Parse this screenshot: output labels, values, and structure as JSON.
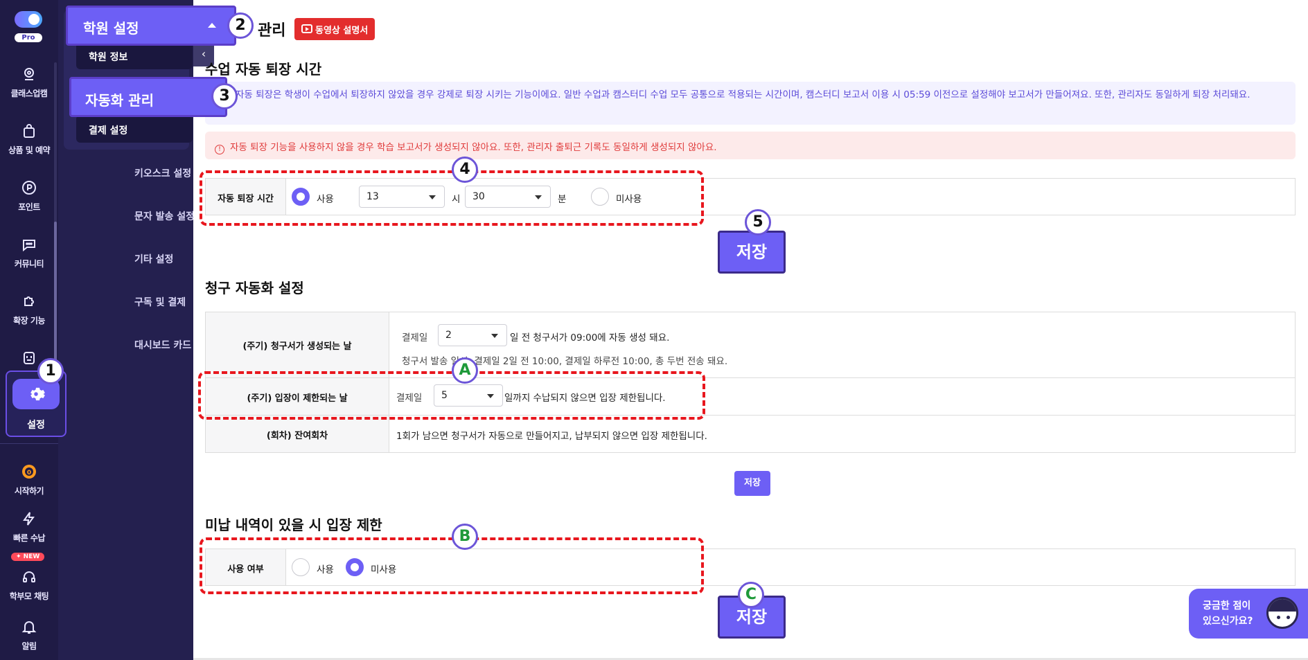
{
  "rail": {
    "pro_label": "Pro",
    "items": [
      {
        "label": "클래스업캠",
        "icon": "pin-icon"
      },
      {
        "label": "상품 및 예약",
        "icon": "bag-icon"
      },
      {
        "label": "포인트",
        "icon": "point-icon"
      },
      {
        "label": "커뮤니티",
        "icon": "chat-icon"
      },
      {
        "label": "확장 기능",
        "icon": "puzzle-icon"
      },
      {
        "label": "",
        "icon": "kiosk-icon"
      }
    ],
    "settings_label": "설정",
    "bottom_items": [
      {
        "label": "시작하기",
        "icon": "start-icon"
      },
      {
        "label": "빠른 수납",
        "icon": "bolt-icon"
      },
      {
        "label": "학부모 채팅",
        "icon": "headset-icon"
      },
      {
        "label": "알림",
        "icon": "bell-icon"
      }
    ],
    "new_badge": "✦ NEW"
  },
  "submenu": {
    "group_title": "학원 설정",
    "items": [
      "학원 정보",
      "자동화 관리",
      "결제 설정"
    ],
    "links": [
      "키오스크 설정",
      "문자 발송 설정",
      "기타 설정",
      "구독 및 결제",
      "대시보드 카드 설정"
    ]
  },
  "main": {
    "page_title": "관리",
    "video_btn": "동영상 설명서",
    "section1": {
      "title": "수업 자동 퇴장 시간",
      "info": "자동 퇴장은 학생이 수업에서 퇴장하지 않았을 경우 강제로 퇴장 시키는 기능이에요. 일반 수업과 캠스터디 수업 모두 공통으로 적용되는 시간이며, 캠스터디 보고서 이용 시 05:59 이전으로 설정해야 보고서가 만들어져요. 또한, 관리자도 동일하게 퇴장 처리돼요.",
      "warning": "자동 퇴장 기능을 사용하지 않을 경우 학습 보고서가 생성되지 않아요. 또한, 관리자 출퇴근 기록도 동일하게 생성되지 않아요.",
      "row_label": "자동 퇴장 시간",
      "use_label": "사용",
      "hour_value": "13",
      "hour_unit": "시",
      "minute_value": "30",
      "minute_unit": "분",
      "unuse_label": "미사용",
      "save_label": "저장"
    },
    "section2": {
      "title": "청구 자동화 설정",
      "row1_label": "(주기) 청구서가 생성되는 날",
      "row1_prefix": "결제일",
      "row1_value": "2",
      "row1_suffix": "일 전 청구서가 09:00에 자동 생성 돼요.",
      "row1_note": "청구서 발송 일시: 결제일 2일 전 10:00, 결제일 하루전 10:00, 총 두번 전송 돼요.",
      "row2_label": "(주기) 입장이 제한되는 날",
      "row2_prefix": "결제일",
      "row2_value": "5",
      "row2_suffix": "일까지 수납되지 않으면 입장 제한됩니다.",
      "row3_label": "(회차) 잔여회차",
      "row3_text": "1회가 남으면 청구서가 자동으로 만들어지고, 납부되지 않으면 입장 제한됩니다.",
      "save_label": "저장"
    },
    "section3": {
      "title": "미납 내역이 있을 시 입장 제한",
      "row_label": "사용 여부",
      "use_label": "사용",
      "unuse_label": "미사용",
      "save_label": "저장"
    },
    "help": {
      "line1": "궁금한 점이",
      "line2": "있으신가요?"
    }
  },
  "steps": [
    "1",
    "2",
    "3",
    "4",
    "5",
    "A",
    "B",
    "C"
  ],
  "colors": {
    "accent": "#6d5ff5",
    "rail_bg": "#1f1b45",
    "annotation": "#e8171e",
    "warning": "#e03b3b"
  }
}
